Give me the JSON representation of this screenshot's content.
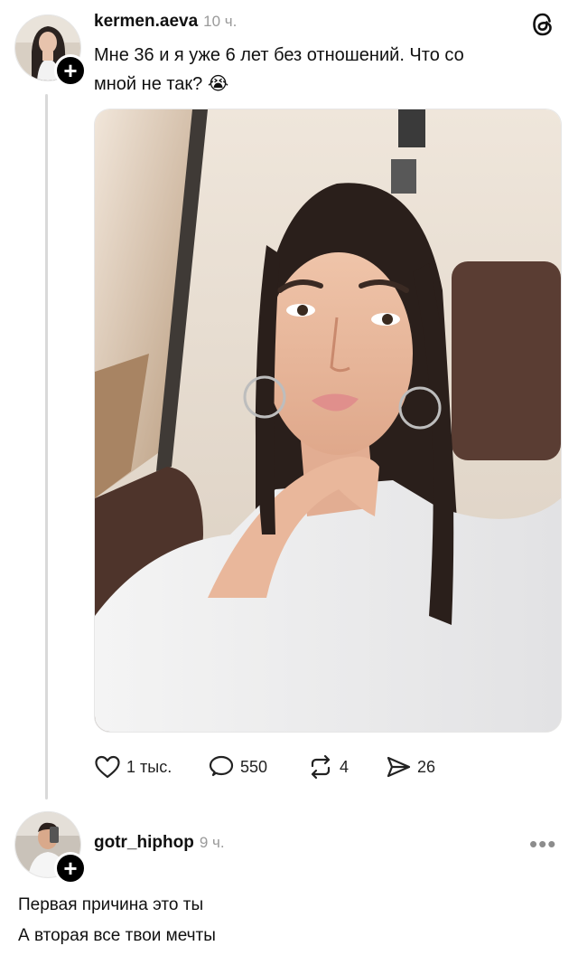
{
  "post": {
    "username": "kermen.aeva",
    "time": "10 ч.",
    "text_line1": "Мне 36 и я уже 6 лет без отношений. Что со",
    "text_line2": "мной не так?",
    "emoji": "😭",
    "actions": {
      "likes": "1 тыс.",
      "comments": "550",
      "reposts": "4",
      "shares": "26"
    }
  },
  "reply": {
    "username": "gotr_hiphop",
    "time": "9 ч.",
    "more_label": "•••",
    "line1": "Первая причина это ты",
    "line2": "А вторая все твои мечты"
  },
  "icons": {
    "app_logo": "threads-logo-icon",
    "follow": "plus-icon",
    "like": "heart-icon",
    "comment": "comment-bubble-icon",
    "repost": "repost-icon",
    "share": "send-icon"
  },
  "colors": {
    "text": "#101010",
    "muted": "#9a9a9a",
    "thread_line": "#d9d9d9",
    "lip": "#e08f8c"
  }
}
